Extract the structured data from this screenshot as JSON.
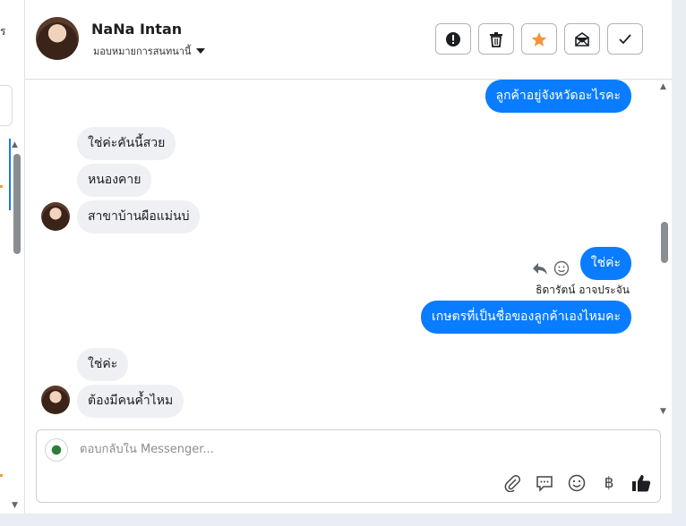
{
  "sidebar_fragment": {
    "text": "ร"
  },
  "header": {
    "contact_name": "NaNa Intan",
    "assign_label": "มอบหมายการสนทนานี้",
    "actions": [
      {
        "name": "report-icon"
      },
      {
        "name": "trash-icon"
      },
      {
        "name": "star-icon"
      },
      {
        "name": "mark-unread-icon"
      },
      {
        "name": "check-icon"
      }
    ]
  },
  "messages": [
    {
      "dir": "out",
      "text": "ลูกค้าอยู่จังหวัดอะไรคะ"
    },
    {
      "dir": "in",
      "text": "ใช่ค่ะคันนี้สวย"
    },
    {
      "dir": "in",
      "text": "หนองคาย"
    },
    {
      "dir": "in",
      "text": "สาขาบ้านผือแม่นบ่"
    },
    {
      "dir": "out",
      "text": "ใช่ค่ะ"
    },
    {
      "dir": "out",
      "text": "เกษตรที่เป็นชื่อของลูกค้าเองไหมคะ"
    },
    {
      "dir": "in",
      "text": "ใช่ค่ะ"
    },
    {
      "dir": "in",
      "text": "ต้องมีคนค้ำไหม"
    }
  ],
  "sender_label": "ธิดารัตน์ อาจประจัน",
  "composer": {
    "placeholder": "ตอบกลับใน Messenger...",
    "tools": [
      "attach-icon",
      "saved-reply-icon",
      "emoji-icon",
      "baht-icon",
      "like-icon"
    ],
    "baht_symbol": "฿"
  },
  "colors": {
    "accent": "#0a7cff",
    "incoming_bg": "#eef0f3",
    "star": "#f5943c"
  }
}
